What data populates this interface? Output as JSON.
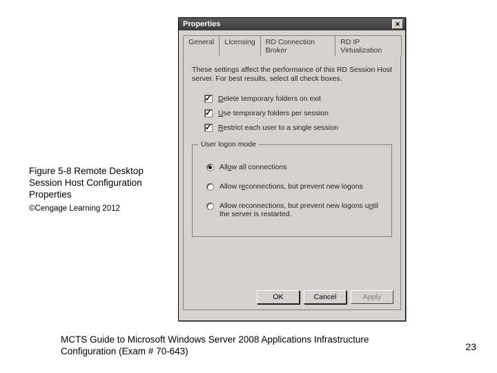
{
  "caption": {
    "title": "Figure 5-8 Remote Desktop Session Host Configuration Properties",
    "copyright": "©Cengage Learning 2012"
  },
  "footer": {
    "text": "MCTS Guide to Microsoft Windows Server 2008 Applications Infrastructure Configuration (Exam # 70-643)",
    "page": "23"
  },
  "dialog": {
    "title": "Properties",
    "tabs": [
      "General",
      "Licensing",
      "RD Connection Broker",
      "RD IP Virtualization"
    ],
    "active_tab": 0,
    "description": "These settings affect the performance of this RD Session Host server. For best results, select all check boxes.",
    "checkboxes": [
      {
        "checked": true,
        "pre": "",
        "accel": "D",
        "post": "elete temporary folders on exit"
      },
      {
        "checked": true,
        "pre": "",
        "accel": "U",
        "post": "se temporary folders per session"
      },
      {
        "checked": true,
        "pre": "",
        "accel": "R",
        "post": "estrict each user to a single session"
      }
    ],
    "group": {
      "title": "User logon mode",
      "radios": [
        {
          "selected": true,
          "pre": "All",
          "accel": "o",
          "post": "w all connections"
        },
        {
          "selected": false,
          "pre": "Allow r",
          "accel": "e",
          "post": "connections, but prevent new logons"
        },
        {
          "selected": false,
          "pre": "Allow reconnections, but prevent new logons u",
          "accel": "n",
          "post": "til the server is restarted."
        }
      ]
    },
    "buttons": {
      "ok": "OK",
      "cancel": "Cancel",
      "apply": "Apply"
    }
  }
}
